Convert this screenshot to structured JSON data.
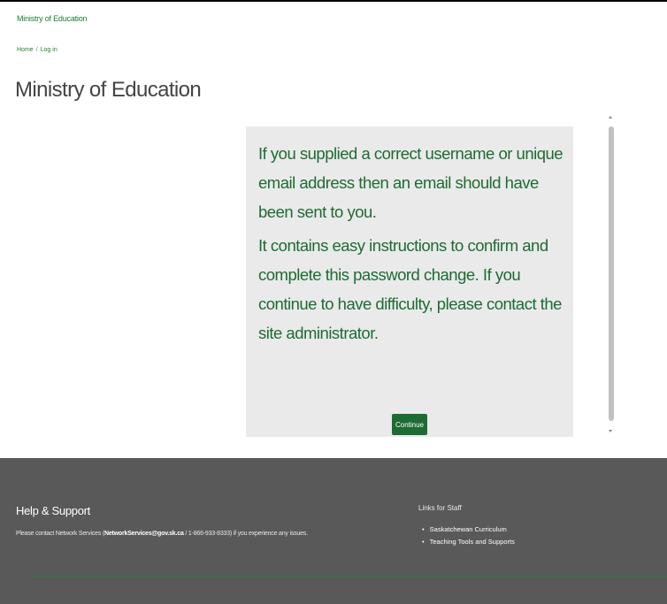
{
  "header": {
    "site_name": "Ministry of Education"
  },
  "breadcrumb": {
    "items": [
      "Home",
      "Log in"
    ],
    "separator": "/"
  },
  "page": {
    "title": "Ministry of Education"
  },
  "message": {
    "paragraph1": "If you supplied a correct username or unique email address then an email should have been sent to you.",
    "paragraph2": "It contains easy instructions to confirm and complete this password change. If you continue to have difficulty, please contact the site administrator.",
    "continue_label": "Continue"
  },
  "footer": {
    "help_heading": "Help & Support",
    "help_text_prefix": "Please contact Network Services (",
    "help_email": "NetworkServices@gov.sk.ca",
    "help_text_suffix": " / 1-866-933-8333) if you experience any issues.",
    "links_heading": "Links for Staff",
    "links": [
      "Saskatchewan Curriculum",
      "Teaching Tools and Supports"
    ]
  },
  "colors": {
    "brand_green": "#1e6b33",
    "footer_bg": "#595959",
    "panel_bg": "#eaeaea"
  }
}
